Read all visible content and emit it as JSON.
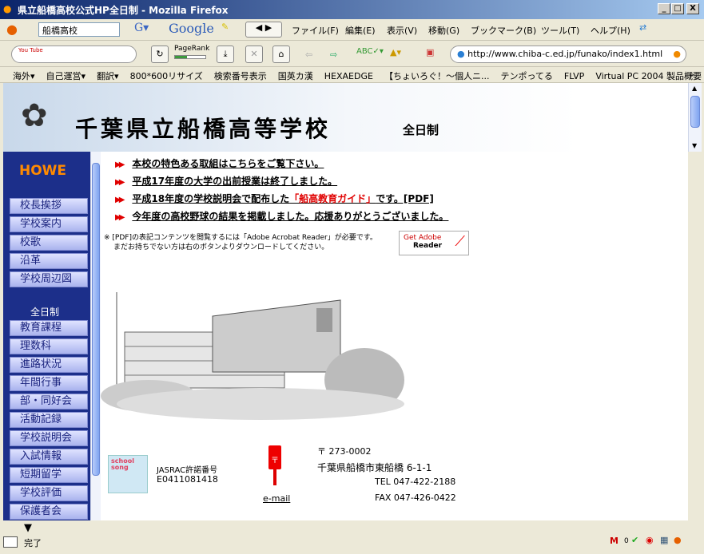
{
  "window": {
    "title": "県立船橋高校公式HP全日制 - Mozilla Firefox",
    "min": "_",
    "max": "□",
    "close": "X"
  },
  "toolbar": {
    "search_value": "船橋高校",
    "google": "Google",
    "pagerank": "PageRank",
    "pagerank_fill": 0.4,
    "menu": [
      "ファイル(F)",
      "編集(E)",
      "表示(V)",
      "移動(G)",
      "ブックマーク(B)",
      "ツール(T)",
      "ヘルプ(H)"
    ],
    "url": "http://www.chiba-c.ed.jp/funako/index1.html",
    "youtube": "You Tube"
  },
  "bookmarks": [
    "海外▾",
    "自己運営▾",
    "翻訳▾",
    "800*600リサイズ",
    "検索番号表示",
    "国英カ漢",
    "HEXAEDGE",
    "【ちょいろぐ！〜個人ニ...",
    "テンポってる",
    "FLVP",
    "Virtual PC 2004 製品概要"
  ],
  "bookmarks_more": "»",
  "banner": {
    "title": "千葉県立船橋高等学校",
    "sub": "全日制"
  },
  "sidebar": {
    "logo": "HOWE",
    "section": "全日制",
    "items_top": [
      "校長挨拶",
      "学校案内",
      "校歌",
      "沿革",
      "学校周辺図"
    ],
    "items_main": [
      "教育課程",
      "理数科",
      "進路状況",
      "年間行事",
      "部・同好会",
      "活動記録",
      "学校説明会",
      "入試情報",
      "短期留学",
      "学校評価",
      "保護者会"
    ]
  },
  "news": [
    {
      "text": "本校の特色ある取組はこちらをご覧下さい。"
    },
    {
      "text": "平成17年度の大学の出前授業は終了しました。"
    },
    {
      "text": "平成18年度の学校説明会で配布した",
      "highlight": "「船高教育ガイド」",
      "suffix": "です。[PDF]"
    },
    {
      "text": "今年度の高校野球の結果を掲載しました。応援ありがとうございました。"
    }
  ],
  "pdf_note": {
    "line1": "※ [PDF]の表記コンテンツを閲覧するには「Adobe Acrobat Reader」が必要です。",
    "line2": "まだお持ちでない方は右のボタンよりダウンロードしてください。",
    "button_get": "Get Adobe",
    "button_reader": "Reader"
  },
  "footer": {
    "jasrac_logo": "school song licensed by JASRAC",
    "jasrac_label": "JASRAC許諾番号",
    "jasrac_no": "E0411081418",
    "email": "e-mail",
    "postal": "〒 273-0002",
    "address": "千葉県船橋市東船橋 6-1-1",
    "tel": "TEL 047-422-2188",
    "fax": "FAX 047-426-0422"
  },
  "status": {
    "text": "完了",
    "gmail_count": "0"
  },
  "colors": {
    "title_bar": "#0a246a",
    "sidebar": "#1c2f8a",
    "news_arrow": "#e00000",
    "highlight": "#e00000"
  }
}
